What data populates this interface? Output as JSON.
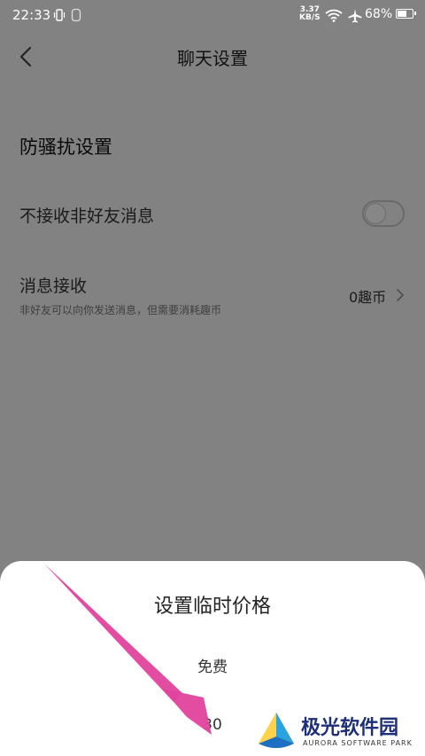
{
  "status_bar": {
    "time": "22:33",
    "speed_value": "3.37",
    "speed_unit": "KB/S",
    "battery": "68%",
    "battery_level": 0.68
  },
  "header": {
    "title": "聊天设置"
  },
  "settings": {
    "section_title": "防骚扰设置",
    "no_stranger_label": "不接收非好友消息",
    "no_stranger_enabled": false,
    "msg_receive_label": "消息接收",
    "msg_receive_desc": "非好友可以向你发送消息，但需要消耗趣币",
    "msg_receive_value": "0趣币"
  },
  "sheet": {
    "title": "设置临时价格",
    "options": [
      "免费",
      "30"
    ]
  },
  "watermark": {
    "name": "极光软件园",
    "sub": "AURORA SOFTWARE PARK"
  },
  "colors": {
    "arrow": "#e0439c",
    "watermark": "#1d2f7a"
  }
}
